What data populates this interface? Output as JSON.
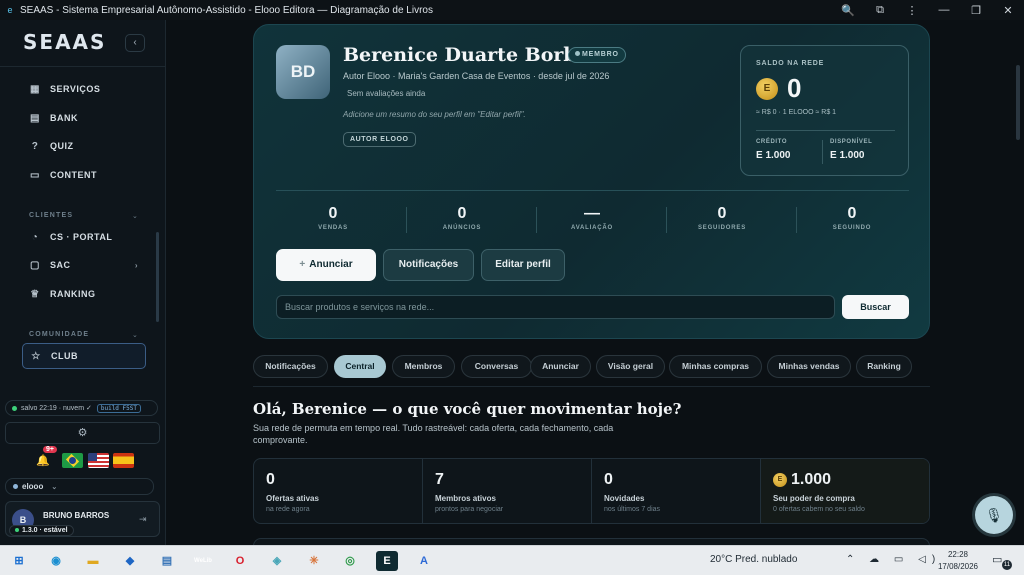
{
  "window": {
    "title": "SEAAS - Sistema Empresarial Autônomo-Assistido - Elooo Editora — Diagramação de Livros",
    "controls": [
      "🔍",
      "⧉",
      "⋮",
      "—",
      "❐",
      "✕"
    ]
  },
  "sidebar": {
    "logo": "SEAAS",
    "collapse": "‹",
    "items_top": [
      {
        "label": "SERVIÇOS",
        "icon": "grid-icon",
        "glyph": "▦"
      },
      {
        "label": "BANK",
        "icon": "bank-icon",
        "glyph": "▤"
      },
      {
        "label": "QUIZ",
        "icon": "help-circle-icon",
        "glyph": "?"
      },
      {
        "label": "CONTENT",
        "icon": "document-icon",
        "glyph": "▭"
      }
    ],
    "section_clientes": "CLIENTES",
    "items_clientes": [
      {
        "label": "CS · PORTAL",
        "icon": "headset-icon",
        "glyph": "◔"
      },
      {
        "label": "SAC",
        "icon": "chat-icon",
        "glyph": "▢"
      },
      {
        "label": "RANKING",
        "icon": "trophy-icon",
        "glyph": "♕"
      }
    ],
    "section_comunidade": "COMUNIDADE",
    "club": {
      "label": "CLUB",
      "glyph": "☆"
    },
    "status": "salvo 22:19 · nuvem ✓",
    "build": "build F5ST",
    "settings_glyph": "⚙",
    "notif_glyph": "🔔",
    "notif_badge": "9+",
    "org": "elooo",
    "user_name": "BRUNO BARROS",
    "user_initial": "B",
    "logout_glyph": "⇥",
    "version": "1.3.0 · estável"
  },
  "profile": {
    "initials": "BD",
    "name": "Berenice Duarte Borba",
    "badge": "MEMBRO",
    "subtitle": "Autor Elooo · Maria's Garden Casa de Eventos · desde jul de 2026",
    "rating": "Sem avaliações ainda",
    "summary_hint": "Adicione um resumo do seu perfil em \"Editar perfil\".",
    "role": "AUTOR ELOOO"
  },
  "wallet": {
    "label": "SALDO NA REDE",
    "coin": "E",
    "value": "0",
    "conversion": "≈ R$ 0 · 1 ELOOO ≈ R$ 1",
    "credit_label": "CRÉDITO",
    "credit_value": "E 1.000",
    "available_label": "DISPONÍVEL",
    "available_value": "E 1.000"
  },
  "stats": [
    {
      "value": "0",
      "label": "VENDAS"
    },
    {
      "value": "0",
      "label": "ANÚNCIOS"
    },
    {
      "value": "—",
      "label": "AVALIAÇÃO"
    },
    {
      "value": "0",
      "label": "SEGUIDORES"
    },
    {
      "value": "0",
      "label": "SEGUINDO"
    }
  ],
  "actions": {
    "announce": "Anunciar",
    "announce_plus": "+",
    "notifications": "Notificações",
    "edit_profile": "Editar perfil"
  },
  "search": {
    "placeholder": "Buscar produtos e serviços na rede...",
    "button": "Buscar"
  },
  "tabs": [
    {
      "label": "Notificações",
      "active": false
    },
    {
      "label": "Central",
      "active": true
    },
    {
      "label": "Membros",
      "active": false
    },
    {
      "label": "Conversas",
      "active": false
    },
    {
      "label": "Anunciar",
      "active": false
    },
    {
      "label": "Visão geral",
      "active": false
    },
    {
      "label": "Minhas compras",
      "active": false
    },
    {
      "label": "Minhas vendas",
      "active": false
    },
    {
      "label": "Ranking",
      "active": false
    }
  ],
  "greeting": {
    "title": "Olá, Berenice — o que você quer movimentar hoje?",
    "subtitle": "Sua rede de permuta em tempo real. Tudo rastreável: cada oferta, cada fechamento, cada comprovante."
  },
  "kpis": [
    {
      "value": "0",
      "label": "Ofertas ativas",
      "sub": "na rede agora"
    },
    {
      "value": "7",
      "label": "Membros ativos",
      "sub": "prontos para negociar"
    },
    {
      "value": "0",
      "label": "Novidades",
      "sub": "nos últimos 7 dias"
    },
    {
      "value": "1.000",
      "label": "Seu poder de compra",
      "sub": "0 ofertas cabem no seu saldo",
      "coin": "E"
    }
  ],
  "mic_glyph": "🎙",
  "taskbar": {
    "weather": "20°C  Pred. nublado",
    "tray": "⌃ ☁ ▭ ◁)",
    "time": "22:28",
    "date": "17/08/2026",
    "notif_count": "11",
    "apps": [
      {
        "name": "start-icon",
        "glyph": "⊞",
        "color": "#1b6fd1"
      },
      {
        "name": "edge-icon",
        "glyph": "◉",
        "color": "#1b8fd1"
      },
      {
        "name": "file-explorer-icon",
        "glyph": "▬",
        "color": "#e0a820"
      },
      {
        "name": "outlook-icon",
        "glyph": "◆",
        "color": "#1e66c4"
      },
      {
        "name": "notepad-icon",
        "glyph": "▤",
        "color": "#3a76b8"
      },
      {
        "name": "welib-icon",
        "glyph": "WeLib",
        "color": "#5a2a86"
      },
      {
        "name": "opera-icon",
        "glyph": "O",
        "color": "#d81f2d"
      },
      {
        "name": "folder-icon",
        "glyph": "◈",
        "color": "#4aa7b8"
      },
      {
        "name": "claude-icon",
        "glyph": "✳",
        "color": "#d8743a"
      },
      {
        "name": "chrome-icon",
        "glyph": "◎",
        "color": "#2e9a4a"
      },
      {
        "name": "elooo-app-icon",
        "glyph": "E",
        "color": "#0f2a31"
      },
      {
        "name": "arc-icon",
        "glyph": "A",
        "color": "#2e6ad6"
      }
    ]
  }
}
